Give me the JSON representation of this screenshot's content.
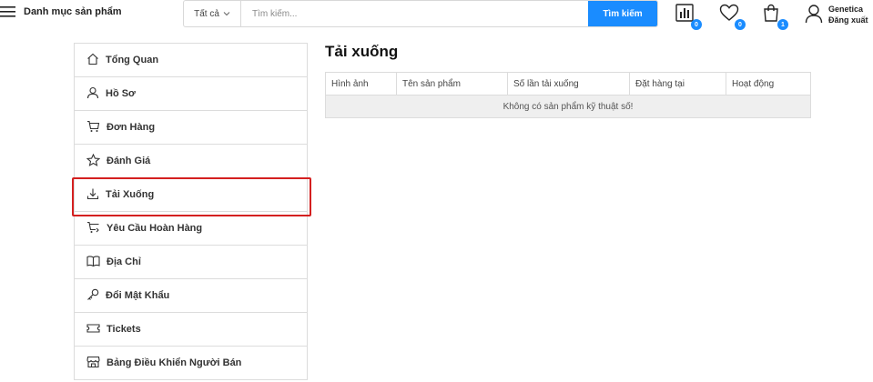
{
  "header": {
    "menu_label": "Danh mục sản phẩm",
    "search": {
      "category": "Tất cả",
      "placeholder": "Tìm kiếm...",
      "button_label": "Tìm kiếm"
    },
    "compare_count": "0",
    "wishlist_count": "0",
    "cart_count": "1",
    "account": {
      "username": "Genetica",
      "logout_label": "Đăng xuất"
    },
    "accent_color": "#1a8cff"
  },
  "sidebar": {
    "items": [
      {
        "label": "Tổng Quan",
        "icon": "home-icon"
      },
      {
        "label": "Hồ Sơ",
        "icon": "user-icon"
      },
      {
        "label": "Đơn Hàng",
        "icon": "cart-icon"
      },
      {
        "label": "Đánh Giá",
        "icon": "star-icon"
      },
      {
        "label": "Tải Xuống",
        "icon": "download-icon",
        "active": true
      },
      {
        "label": "Yêu Cầu Hoàn Hàng",
        "icon": "cart-return-icon"
      },
      {
        "label": "Địa Chỉ",
        "icon": "book-icon"
      },
      {
        "label": "Đổi Mật Khẩu",
        "icon": "key-icon"
      },
      {
        "label": "Tickets",
        "icon": "ticket-icon"
      },
      {
        "label": "Bảng Điều Khiển Người Bán",
        "icon": "store-icon"
      }
    ],
    "highlight_color": "#d42020"
  },
  "main": {
    "title": "Tải xuống",
    "table": {
      "columns": [
        "Hình ảnh",
        "Tên sản phẩm",
        "Số lần tải xuống",
        "Đặt hàng tại",
        "Hoạt động"
      ],
      "empty_message": "Không có sản phẩm kỹ thuật số!"
    }
  }
}
